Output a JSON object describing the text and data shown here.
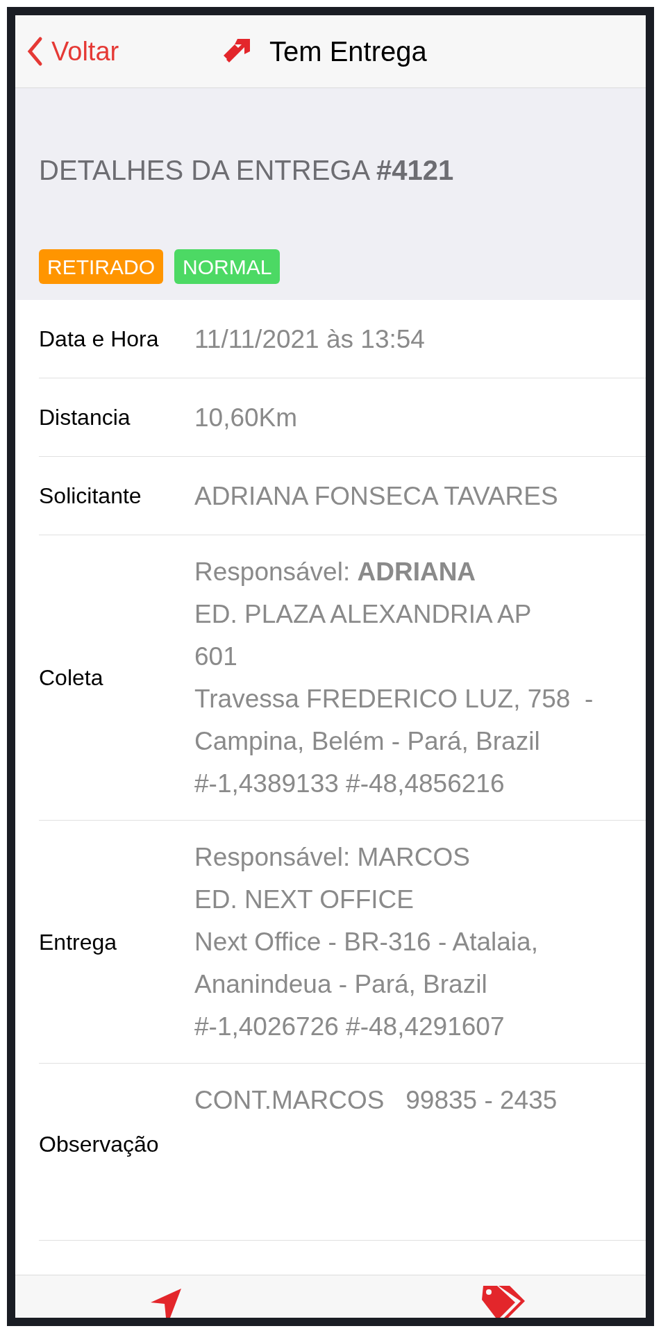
{
  "nav": {
    "back": "Voltar",
    "title": "Tem Entrega"
  },
  "heading": "DETALHES DA ENTREGA **#4121**",
  "badges": [
    {
      "label": "RETIRADO",
      "color": "#ff9500"
    },
    {
      "label": "NORMAL",
      "color": "#4cd964"
    }
  ],
  "rows": [
    {
      "label": "Data e Hora",
      "lines": [
        "11/11/2021 às 13:54"
      ]
    },
    {
      "label": "Distancia",
      "lines": [
        "10,60Km"
      ]
    },
    {
      "label": "Solicitante",
      "lines": [
        "ADRIANA FONSECA TAVARES"
      ]
    },
    {
      "label": "Coleta",
      "lines": [
        "Responsável: **ADRIANA**",
        "ED. PLAZA ALEXANDRIA AP",
        "601",
        "Travessa FREDERICO LUZ, 758  -",
        "Campina, Belém - Pará, Brazil",
        "#-1,4389133 #-48,4856216"
      ]
    },
    {
      "label": "Entrega",
      "lines": [
        "Responsável: MARCOS",
        "ED. NEXT OFFICE",
        "Next Office - BR-316 - Atalaia,",
        "Ananindeua - Pará, Brazil",
        "#-1,4026726 #-48,4291607"
      ]
    },
    {
      "label": "Observação",
      "lines": [
        "CONT.MARCOS   99835 - 2435"
      ],
      "tall": true
    }
  ]
}
